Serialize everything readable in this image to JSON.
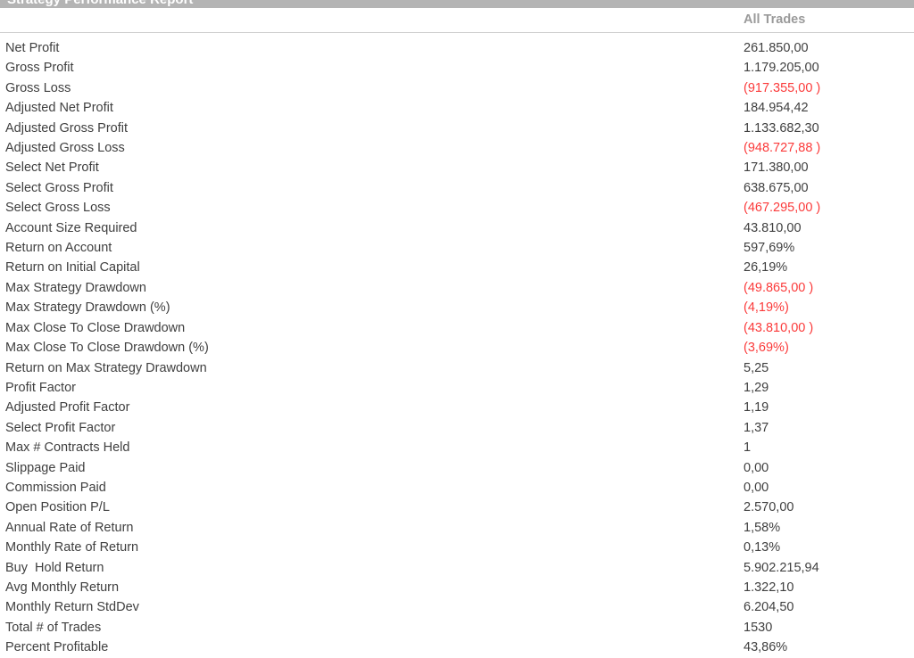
{
  "window": {
    "title": "Strategy Performance Report"
  },
  "table": {
    "columns": [
      "",
      "All Trades"
    ],
    "all_trades_header": "All Trades",
    "negative_color": "#fb3a3a",
    "text_color": "#3f3f3f",
    "header_color": "#9a9a9a",
    "rows": [
      {
        "label": "Net Profit",
        "value": "261.850,00",
        "negative": false
      },
      {
        "label": "Gross Profit",
        "value": "1.179.205,00",
        "negative": false
      },
      {
        "label": "Gross Loss",
        "value": "(917.355,00 )",
        "negative": true
      },
      {
        "label": "Adjusted Net Profit",
        "value": "184.954,42",
        "negative": false
      },
      {
        "label": "Adjusted Gross Profit",
        "value": "1.133.682,30",
        "negative": false
      },
      {
        "label": "Adjusted Gross Loss",
        "value": "(948.727,88 )",
        "negative": true
      },
      {
        "label": "Select Net Profit",
        "value": "171.380,00",
        "negative": false
      },
      {
        "label": "Select Gross Profit",
        "value": "638.675,00",
        "negative": false
      },
      {
        "label": "Select Gross Loss",
        "value": "(467.295,00 )",
        "negative": true
      },
      {
        "label": "Account Size Required",
        "value": "43.810,00",
        "negative": false
      },
      {
        "label": "Return on Account",
        "value": "597,69%",
        "negative": false
      },
      {
        "label": "Return on Initial Capital",
        "value": "26,19%",
        "negative": false
      },
      {
        "label": "Max Strategy Drawdown",
        "value": "(49.865,00 )",
        "negative": true
      },
      {
        "label": "Max Strategy Drawdown (%)",
        "value": "(4,19%)",
        "negative": true
      },
      {
        "label": "Max Close To Close Drawdown",
        "value": "(43.810,00 )",
        "negative": true
      },
      {
        "label": "Max Close To Close Drawdown (%)",
        "value": "(3,69%)",
        "negative": true
      },
      {
        "label": "Return on Max Strategy Drawdown",
        "value": "5,25",
        "negative": false
      },
      {
        "label": "Profit Factor",
        "value": "1,29",
        "negative": false
      },
      {
        "label": "Adjusted Profit Factor",
        "value": "1,19",
        "negative": false
      },
      {
        "label": "Select Profit Factor",
        "value": "1,37",
        "negative": false
      },
      {
        "label": "Max # Contracts Held",
        "value": "1",
        "negative": false
      },
      {
        "label": "Slippage Paid",
        "value": "0,00",
        "negative": false
      },
      {
        "label": "Commission Paid",
        "value": "0,00",
        "negative": false
      },
      {
        "label": "Open Position P/L",
        "value": "2.570,00",
        "negative": false
      },
      {
        "label": "Annual Rate of Return",
        "value": "1,58%",
        "negative": false
      },
      {
        "label": "Monthly Rate of Return",
        "value": "0,13%",
        "negative": false
      },
      {
        "label": "Buy  Hold Return",
        "value": "5.902.215,94",
        "negative": false
      },
      {
        "label": "Avg Monthly Return",
        "value": "1.322,10",
        "negative": false
      },
      {
        "label": "Monthly Return StdDev",
        "value": "6.204,50",
        "negative": false
      },
      {
        "label": "Total # of Trades",
        "value": "1530",
        "negative": false
      },
      {
        "label": "Percent Profitable",
        "value": "43,86%",
        "negative": false
      }
    ]
  }
}
